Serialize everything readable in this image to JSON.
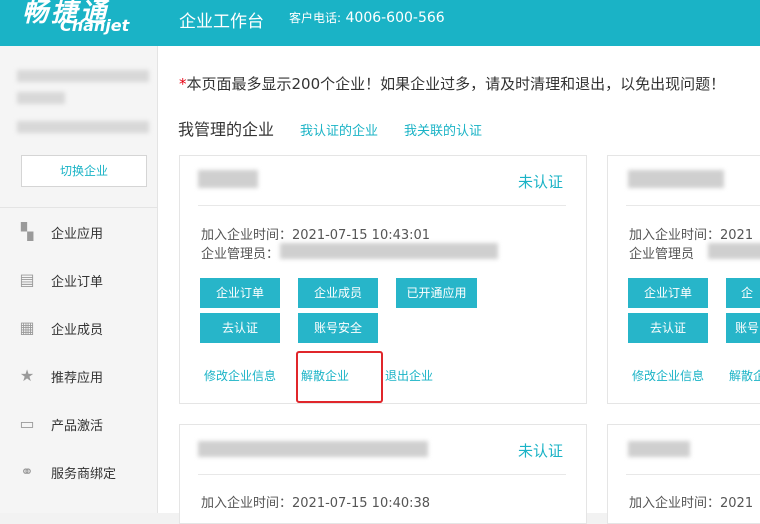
{
  "header": {
    "logo_cn": "畅捷通",
    "logo_en": "Chanjet",
    "app_title": "企业工作台",
    "hotline_label": "客户电话:",
    "hotline_number": "4006-600-566"
  },
  "sidebar": {
    "switch_label": "切换企业",
    "items": [
      {
        "label": "企业应用",
        "icon": "apps-grid-icon"
      },
      {
        "label": "企业订单",
        "icon": "clipboard-icon"
      },
      {
        "label": "企业成员",
        "icon": "building-icon"
      },
      {
        "label": "推荐应用",
        "icon": "star-icon"
      },
      {
        "label": "产品激活",
        "icon": "ticket-icon"
      },
      {
        "label": "服务商绑定",
        "icon": "link-icon"
      }
    ]
  },
  "notice": {
    "star": "*",
    "text": "本页面最多显示200个企业！如果企业过多，请及时清理和退出，以免出现问题！"
  },
  "tabs": {
    "active": "我管理的企业",
    "certified": "我认证的企业",
    "related": "我关联的认证"
  },
  "cards": [
    {
      "status": "未认证",
      "join_time": "加入企业时间：2021-07-15 10:43:01",
      "admin_label": "企业管理员：",
      "buttons": [
        "企业订单",
        "企业成员",
        "已开通应用",
        "去认证",
        "账号安全"
      ],
      "links": [
        "修改企业信息",
        "解散企业",
        "退出企业"
      ]
    },
    {
      "status": "",
      "join_time": "加入企业时间：2021",
      "admin_label": "企业管理员",
      "buttons": [
        "企业订单",
        "企",
        "去认证",
        "账号"
      ],
      "links": [
        "修改企业信息",
        "解散企"
      ]
    },
    {
      "status": "未认证",
      "join_time": "加入企业时间：2021-07-15 10:40:38"
    },
    {
      "join_time": "加入企业时间：2021"
    }
  ],
  "colors": {
    "brand": "#1ab3c6",
    "button": "#27b5c9",
    "warning": "#e60012",
    "highlight": "#e0262b"
  }
}
